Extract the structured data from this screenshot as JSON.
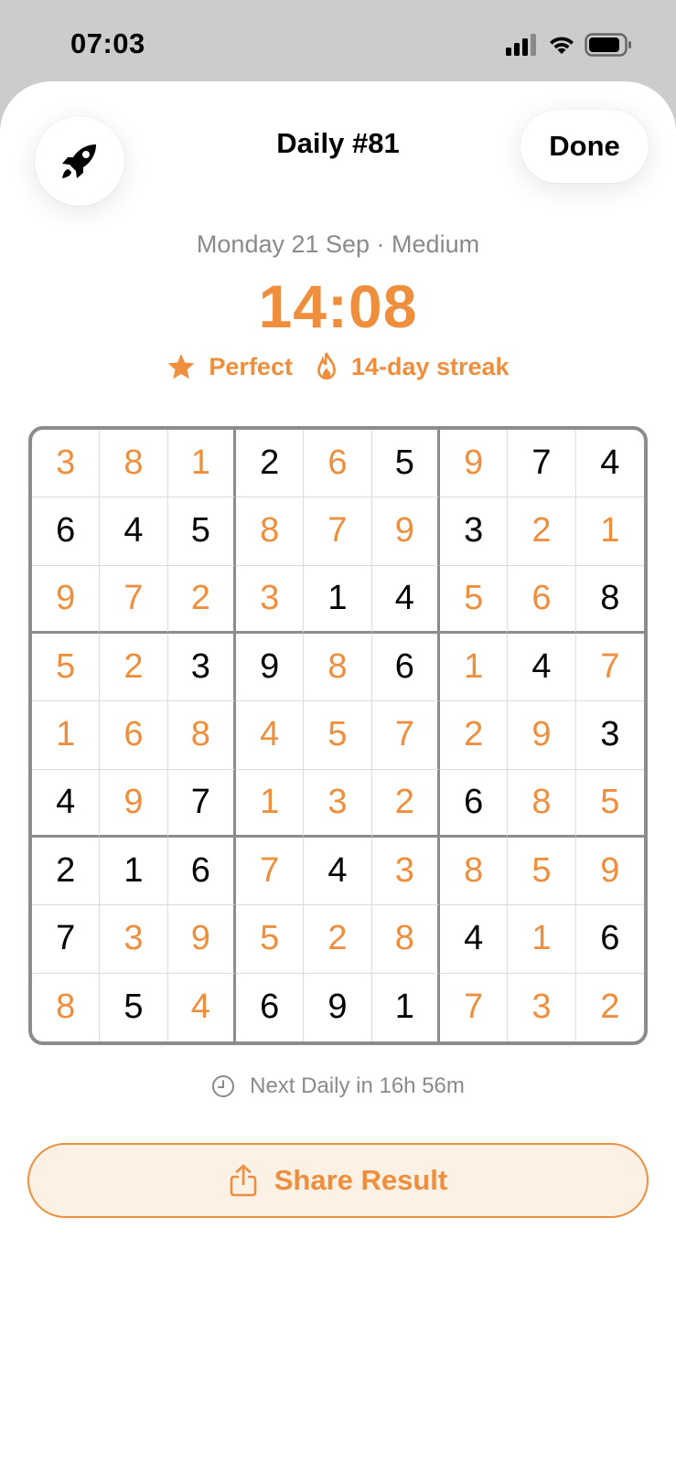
{
  "status_bar": {
    "time": "07:03"
  },
  "header": {
    "left_icon": "rocket-icon",
    "title": "Daily #81",
    "done_label": "Done"
  },
  "summary": {
    "date_difficulty": "Monday 21 Sep · Medium",
    "time": "14:08",
    "badge_perfect": "Perfect",
    "badge_streak": "14-day streak"
  },
  "colors": {
    "accent": "#ef8f3d",
    "muted": "#8a8a8a"
  },
  "board": {
    "rows": [
      [
        3,
        8,
        1,
        2,
        6,
        5,
        9,
        7,
        4
      ],
      [
        6,
        4,
        5,
        8,
        7,
        9,
        3,
        2,
        1
      ],
      [
        9,
        7,
        2,
        3,
        1,
        4,
        5,
        6,
        8
      ],
      [
        5,
        2,
        3,
        9,
        8,
        6,
        1,
        4,
        7
      ],
      [
        1,
        6,
        8,
        4,
        5,
        7,
        2,
        9,
        3
      ],
      [
        4,
        9,
        7,
        1,
        3,
        2,
        6,
        8,
        5
      ],
      [
        2,
        1,
        6,
        7,
        4,
        3,
        8,
        5,
        9
      ],
      [
        7,
        3,
        9,
        5,
        2,
        8,
        4,
        1,
        6
      ],
      [
        8,
        5,
        4,
        6,
        9,
        1,
        7,
        3,
        2
      ]
    ],
    "orange_mask": [
      [
        1,
        1,
        1,
        0,
        1,
        0,
        1,
        0,
        0
      ],
      [
        0,
        0,
        0,
        1,
        1,
        1,
        0,
        1,
        1
      ],
      [
        1,
        1,
        1,
        1,
        0,
        0,
        1,
        1,
        0
      ],
      [
        1,
        1,
        0,
        0,
        1,
        0,
        1,
        0,
        1
      ],
      [
        1,
        1,
        1,
        1,
        1,
        1,
        1,
        1,
        0
      ],
      [
        0,
        1,
        0,
        1,
        1,
        1,
        0,
        1,
        1
      ],
      [
        0,
        0,
        0,
        1,
        0,
        1,
        1,
        1,
        1
      ],
      [
        0,
        1,
        1,
        1,
        1,
        1,
        0,
        1,
        0
      ],
      [
        1,
        0,
        1,
        0,
        0,
        0,
        1,
        1,
        1
      ]
    ]
  },
  "footer": {
    "next_daily": "Next Daily in 16h 56m",
    "share_label": "Share Result"
  }
}
